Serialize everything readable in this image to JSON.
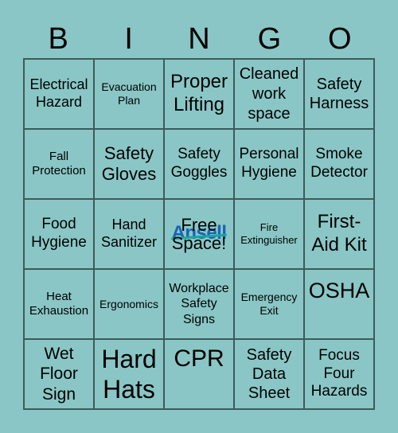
{
  "header": {
    "letters": [
      "B",
      "I",
      "N",
      "G",
      "O"
    ]
  },
  "free_logo": "Ansell",
  "cells": [
    "Electrical Hazard",
    "Evacuation Plan",
    "Proper Lifting",
    "Cleaned work space",
    "Safety Harness",
    "Fall Protection",
    "Safety Gloves",
    "Safety Goggles",
    "Personal Hygiene",
    "Smoke Detector",
    "Food Hygiene",
    "Hand Sanitizer",
    "Free Space!",
    "Fire Extinguisher",
    "First-Aid Kit",
    "Heat Exhaustion",
    "Ergonomics",
    "Workplace Safety Signs",
    "Emergency Exit",
    "OSHA",
    "Wet Floor Sign",
    "Hard Hats",
    "CPR",
    "Safety Data Sheet",
    "Focus Four Hazards"
  ],
  "colors": {
    "background": "#8ac6c6",
    "grid_line": "#3d5a5a",
    "logo": "#1a63b8"
  }
}
